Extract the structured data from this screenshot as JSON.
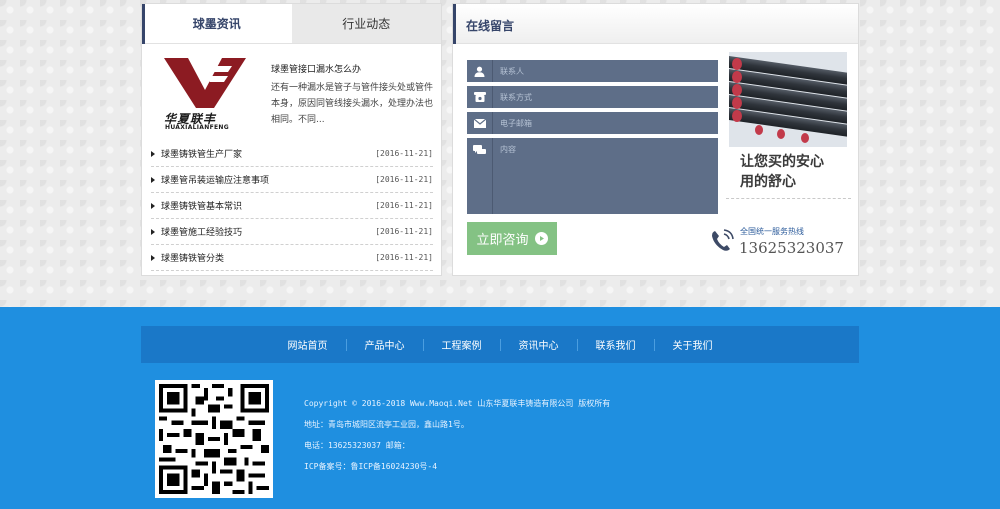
{
  "tabs": [
    {
      "label": "球墨资讯"
    },
    {
      "label": "行业动态"
    }
  ],
  "featured": {
    "logo_cn": "华夏联丰",
    "logo_en": "HUAXIALIANFENG",
    "title": "球墨管接口漏水怎么办",
    "desc": "还有一种漏水是管子与管件接头处或管件本身，原因同管线接头漏水，处理办法也相同。不同..."
  },
  "news": [
    {
      "title": "球墨铸铁管生产厂家",
      "date": "[2016-11-21]"
    },
    {
      "title": "球墨管吊装运输应注意事项",
      "date": "[2016-11-21]"
    },
    {
      "title": "球墨铸铁管基本常识",
      "date": "[2016-11-21]"
    },
    {
      "title": "球墨管施工经验技巧",
      "date": "[2016-11-21]"
    },
    {
      "title": "球墨铸铁管分类",
      "date": "[2016-11-21]"
    }
  ],
  "message": {
    "title": "在线留言",
    "name_placeholder": "联系人",
    "phone_placeholder": "联系方式",
    "email_placeholder": "电子邮箱",
    "content_placeholder": "内容",
    "submit_label": "立即咨询"
  },
  "promo": {
    "line1": "让您买的安心",
    "line2": "用的舒心"
  },
  "hotline": {
    "label": "全国统一服务热线",
    "number": "13625323037"
  },
  "footer_nav": [
    {
      "label": "网站首页"
    },
    {
      "label": "产品中心"
    },
    {
      "label": "工程案例"
    },
    {
      "label": "资讯中心"
    },
    {
      "label": "联系我们"
    },
    {
      "label": "关于我们"
    }
  ],
  "footer": {
    "copyright": "Copyright © 2016-2018 Www.Maoqi.Net 山东华夏联丰铸造有限公司 版权所有",
    "address": "地址：青岛市城阳区流亭工业园，鑫山路1号。",
    "contact": "电话：13625323037   邮箱：",
    "icp": "ICP备案号：鲁ICP备16024230号-4"
  },
  "colors": {
    "accent": "#36456a",
    "footer_bg": "#1f8fe0",
    "footer_nav_bg": "#1a78c8",
    "form_field": "#5e6e88",
    "submit_button": "#84c284"
  }
}
